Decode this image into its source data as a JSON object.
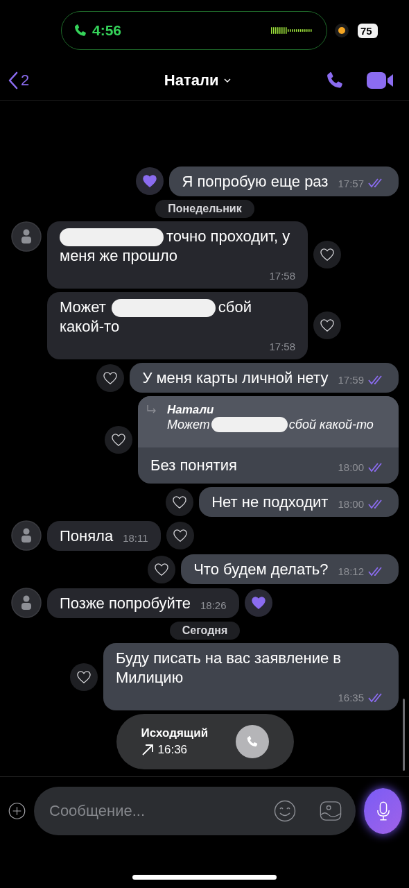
{
  "status_bar": {
    "call_time": "4:56",
    "battery": "75"
  },
  "header": {
    "back_count": "2",
    "title": "Натали"
  },
  "messages": [
    {
      "kind": "outgoing",
      "liked": true,
      "time": "17:57",
      "read": true,
      "parts": [
        {
          "kind": "text",
          "text": "Я попробую еще раз"
        }
      ]
    },
    {
      "kind": "date",
      "text": "Понедельник"
    },
    {
      "kind": "incoming",
      "avatar": true,
      "liked": false,
      "time": "17:58",
      "parts": [
        {
          "kind": "redacted"
        },
        {
          "kind": "text",
          "text": "точно проходит, у меня же прошло"
        }
      ]
    },
    {
      "kind": "incoming",
      "avatar": false,
      "liked": false,
      "time": "17:58",
      "parts": [
        {
          "kind": "text",
          "text": "Может"
        },
        {
          "kind": "redacted"
        },
        {
          "kind": "text",
          "text": "сбой какой-то"
        }
      ]
    },
    {
      "kind": "outgoing",
      "liked": false,
      "time": "17:59",
      "read": true,
      "parts": [
        {
          "kind": "text",
          "text": "У меня карты личной нету"
        }
      ]
    },
    {
      "kind": "outgoing",
      "liked": false,
      "time": "18:00",
      "read": true,
      "reply": {
        "author": "Натали",
        "parts": [
          {
            "kind": "text",
            "text": "Может"
          },
          {
            "kind": "redacted"
          },
          {
            "kind": "text",
            "text": "сбой какой-то"
          }
        ]
      },
      "parts": [
        {
          "kind": "text",
          "text": "Без понятия"
        }
      ]
    },
    {
      "kind": "outgoing",
      "liked": false,
      "time": "18:00",
      "read": true,
      "parts": [
        {
          "kind": "text",
          "text": "Нет не подходит"
        }
      ]
    },
    {
      "kind": "incoming",
      "avatar": true,
      "liked": false,
      "time": "18:11",
      "parts": [
        {
          "kind": "text",
          "text": "Поняла"
        }
      ]
    },
    {
      "kind": "outgoing",
      "liked": false,
      "time": "18:12",
      "read": true,
      "parts": [
        {
          "kind": "text",
          "text": "Что будем делать?"
        }
      ]
    },
    {
      "kind": "incoming",
      "avatar": true,
      "liked": true,
      "time": "18:26",
      "parts": [
        {
          "kind": "text",
          "text": "Позже попробуйте"
        }
      ]
    },
    {
      "kind": "date",
      "text": "Сегодня"
    },
    {
      "kind": "outgoing",
      "liked": false,
      "time": "16:35",
      "read": true,
      "parts": [
        {
          "kind": "text",
          "text": "Буду писать на вас заявление в Милицию"
        }
      ]
    },
    {
      "kind": "call",
      "label": "Исходящий",
      "time": "16:36"
    }
  ],
  "composer": {
    "placeholder": "Сообщение..."
  }
}
